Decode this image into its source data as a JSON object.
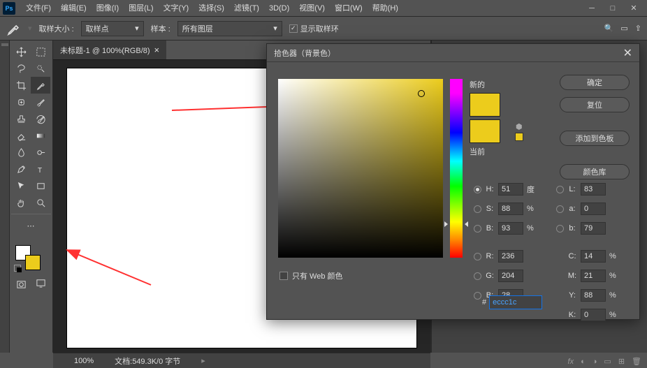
{
  "app": {
    "icon": "Ps"
  },
  "menu": [
    "文件(F)",
    "编辑(E)",
    "图像(I)",
    "图层(L)",
    "文字(Y)",
    "选择(S)",
    "滤镜(T)",
    "3D(D)",
    "视图(V)",
    "窗口(W)",
    "帮助(H)"
  ],
  "options": {
    "sample_size_label": "取样大小 :",
    "sample_size_value": "取样点",
    "sample_label": "样本 :",
    "sample_value": "所有图层",
    "show_ring": "显示取样环"
  },
  "doc_tab": "未标题-1 @ 100%(RGB/8)",
  "status": {
    "zoom": "100%",
    "doc": "文档:549.3K/0 字节"
  },
  "picker": {
    "title": "拾色器（背景色）",
    "new_label": "新的",
    "current_label": "当前",
    "ok": "确定",
    "reset": "复位",
    "add_swatch": "添加到色板",
    "libraries": "颜色库",
    "web_only": "只有 Web 颜色",
    "H": {
      "label": "H:",
      "value": "51",
      "unit": "度"
    },
    "S": {
      "label": "S:",
      "value": "88",
      "unit": "%"
    },
    "Bv": {
      "label": "B:",
      "value": "93",
      "unit": "%"
    },
    "R": {
      "label": "R:",
      "value": "236",
      "unit": ""
    },
    "G": {
      "label": "G:",
      "value": "204",
      "unit": ""
    },
    "B": {
      "label": "B:",
      "value": "28",
      "unit": ""
    },
    "L": {
      "label": "L:",
      "value": "83",
      "unit": ""
    },
    "a": {
      "label": "a:",
      "value": "0",
      "unit": ""
    },
    "b2": {
      "label": "b:",
      "value": "79",
      "unit": ""
    },
    "C": {
      "label": "C:",
      "value": "14",
      "unit": "%"
    },
    "M": {
      "label": "M:",
      "value": "21",
      "unit": "%"
    },
    "Y": {
      "label": "Y:",
      "value": "88",
      "unit": "%"
    },
    "K": {
      "label": "K:",
      "value": "0",
      "unit": "%"
    },
    "hex_label": "#",
    "hex": "eccc1c"
  }
}
